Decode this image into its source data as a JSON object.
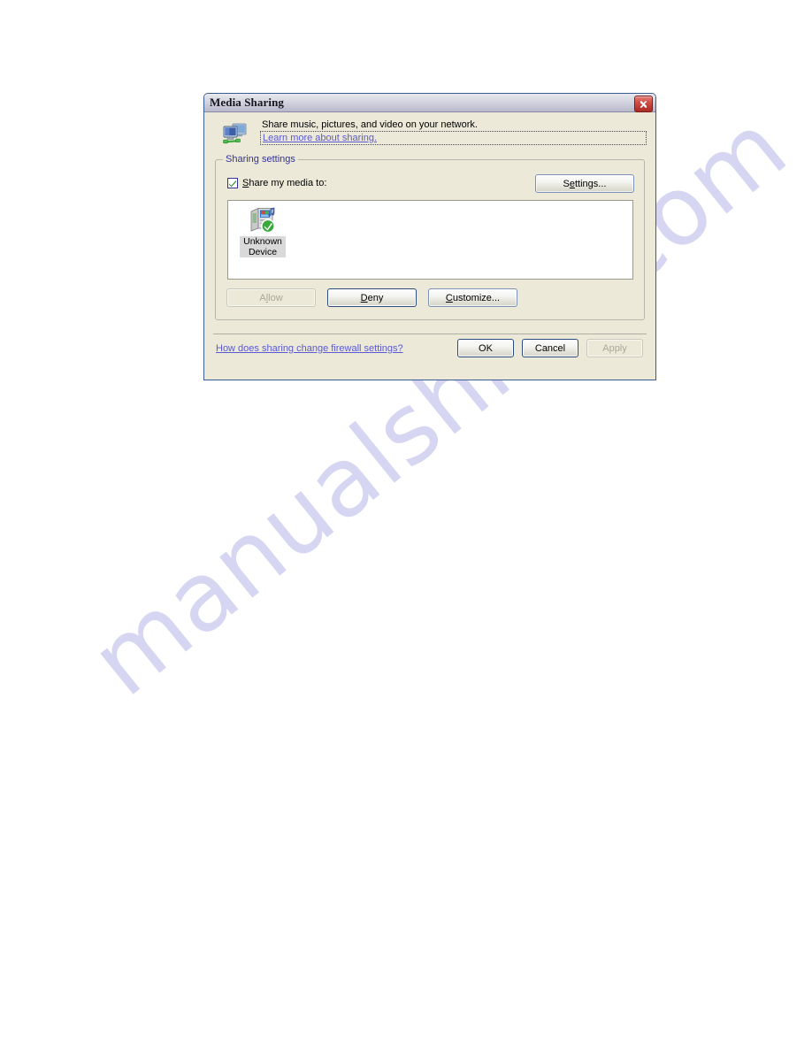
{
  "page": {
    "watermark": "manualshive.com"
  },
  "dialog": {
    "title": "Media Sharing",
    "close_label": "Close",
    "header": {
      "icon": "network-computers-icon",
      "description": "Share music, pictures, and video on your network.",
      "learn_link": "Learn more about sharing."
    },
    "group": {
      "legend": "Sharing settings",
      "checkbox": {
        "label_pre": "S",
        "label_rest": "hare my media to:",
        "full_label": "Share my media to:",
        "checked": true
      },
      "settings_button": {
        "label_pre": "S",
        "label_mid": "e",
        "label_rest": "ttings...",
        "full_label": "Settings..."
      },
      "devices": [
        {
          "name": "Unknown Device",
          "icon": "media-device-allowed-icon",
          "selected": true
        }
      ],
      "actions": [
        {
          "label_pre": "A",
          "label_mid": "l",
          "label_rest": "low",
          "full_label": "Allow",
          "state": "disabled"
        },
        {
          "label_pre": "",
          "label_mid": "D",
          "label_rest": "eny",
          "full_label": "Deny",
          "state": "default"
        },
        {
          "label_pre": "",
          "label_mid": "C",
          "label_rest": "ustomize...",
          "full_label": "Customize...",
          "state": "normal"
        }
      ]
    },
    "footer": {
      "firewall_link": "How does sharing change firewall settings?",
      "buttons": [
        {
          "label": "OK",
          "state": "default"
        },
        {
          "label": "Cancel",
          "state": "default"
        },
        {
          "label": "Apply",
          "state": "disabled"
        }
      ]
    }
  },
  "colors": {
    "dialog_face": "#ece9d8",
    "title_text": "#15151e",
    "link": "#5a5ad2",
    "group_legend": "#32329b",
    "close_red": "#cf4a42",
    "check_green": "#2f8a2f",
    "watermark": "#c9c9ef"
  }
}
